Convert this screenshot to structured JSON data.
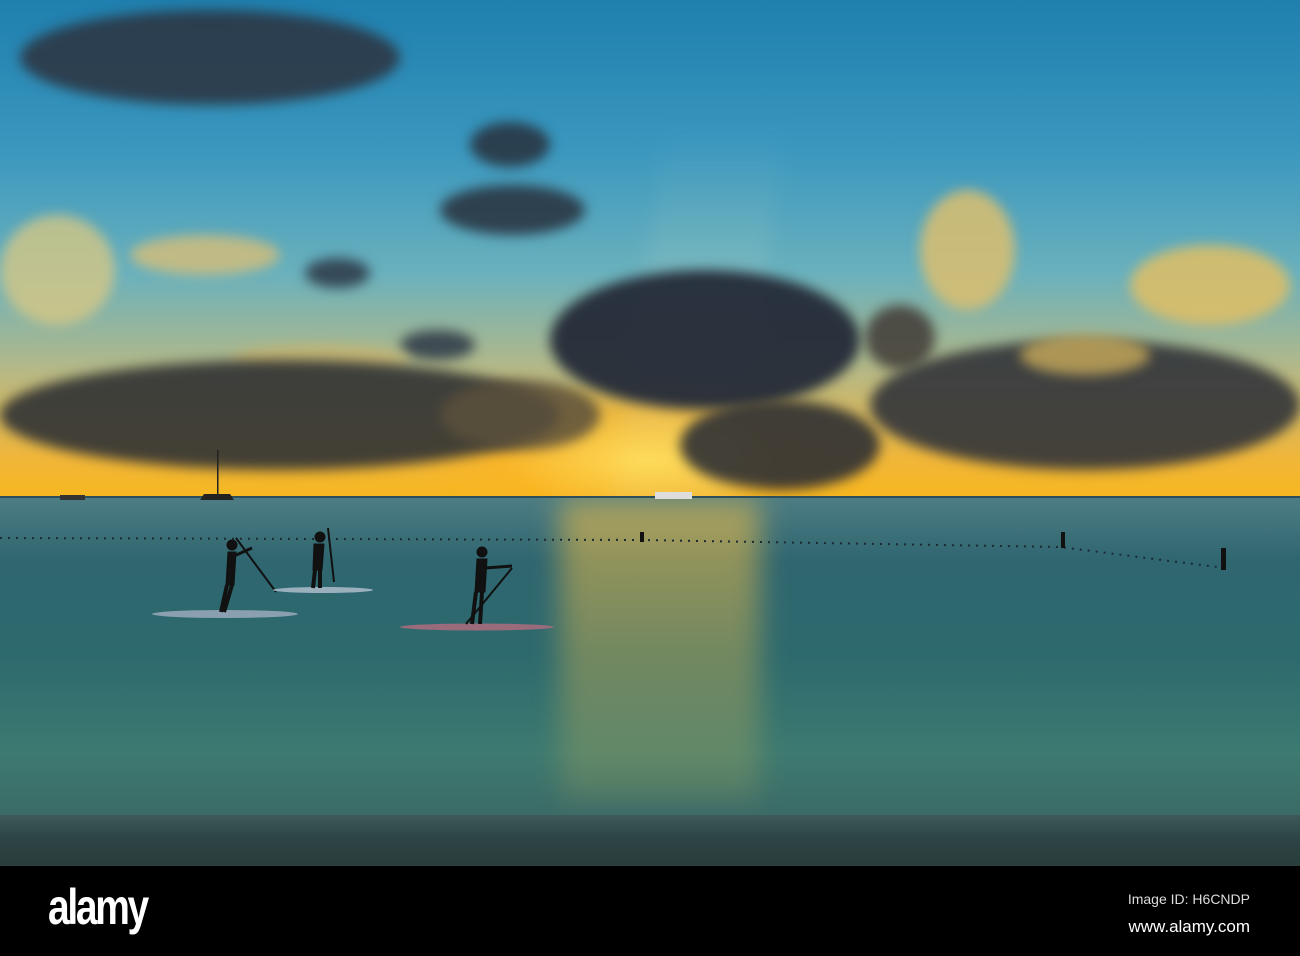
{
  "watermark": {
    "logo": "alamy",
    "image_id": "Image ID: H6CNDP",
    "website": "www.alamy.com"
  },
  "colors": {
    "sky_top": "#1f7fae",
    "sun": "#f6b71f",
    "sea": "#2f6670",
    "cloud": "#2b3140"
  }
}
